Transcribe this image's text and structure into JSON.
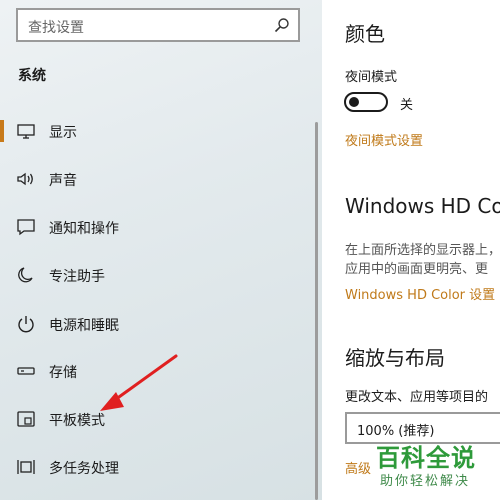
{
  "search": {
    "placeholder": "查找设置"
  },
  "sidebar": {
    "section_title": "系统",
    "items": [
      {
        "label": "显示",
        "icon": "monitor-icon",
        "active": true
      },
      {
        "label": "声音",
        "icon": "speaker-icon"
      },
      {
        "label": "通知和操作",
        "icon": "notification-icon"
      },
      {
        "label": "专注助手",
        "icon": "moon-icon"
      },
      {
        "label": "电源和睡眠",
        "icon": "power-icon"
      },
      {
        "label": "存储",
        "icon": "storage-icon"
      },
      {
        "label": "平板模式",
        "icon": "tablet-icon"
      },
      {
        "label": "多任务处理",
        "icon": "multitask-icon"
      }
    ]
  },
  "main": {
    "color_heading": "颜色",
    "night_mode_label": "夜间模式",
    "night_toggle_state": "关",
    "night_settings_link": "夜间模式设置",
    "hd_heading": "Windows HD Color",
    "hd_desc_line1": "在上面所选择的显示器上，",
    "hd_desc_line2": "应用中的画面更明亮、更",
    "hd_link": "Windows HD Color 设置",
    "scale_heading": "缩放与布局",
    "scale_desc": "更改文本、应用等项目的",
    "scale_value": "100% (推荐)",
    "advanced_link": "高级"
  },
  "watermark": {
    "line1": "百科全说",
    "line2": "助你轻松解决"
  },
  "colors": {
    "accent": "#c87a1a",
    "arrow": "#e02020"
  }
}
